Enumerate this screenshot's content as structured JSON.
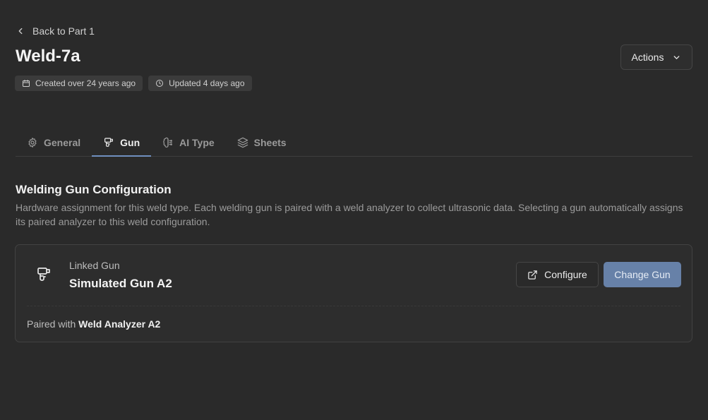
{
  "nav": {
    "back_label": "Back to Part 1"
  },
  "header": {
    "title": "Weld-7a",
    "created": "Created over 24 years ago",
    "updated": "Updated 4 days ago",
    "actions_label": "Actions"
  },
  "tabs": [
    {
      "label": "General",
      "icon": "gear-icon",
      "active": false
    },
    {
      "label": "Gun",
      "icon": "welding-gun-icon",
      "active": true
    },
    {
      "label": "AI Type",
      "icon": "brain-icon",
      "active": false
    },
    {
      "label": "Sheets",
      "icon": "layers-icon",
      "active": false
    }
  ],
  "section": {
    "title": "Welding Gun Configuration",
    "description": "Hardware assignment for this weld type. Each welding gun is paired with a weld analyzer to collect ultrasonic data. Selecting a gun automatically assigns its paired analyzer to this weld configuration."
  },
  "gun_card": {
    "linked_label": "Linked Gun",
    "gun_name": "Simulated Gun A2",
    "configure_label": "Configure",
    "change_label": "Change Gun",
    "paired_prefix": "Paired with",
    "analyzer_name": "Weld Analyzer A2"
  },
  "colors": {
    "background": "#2a2a2a",
    "accent": "#6f8fbf",
    "primary_button": "#6781a8"
  }
}
